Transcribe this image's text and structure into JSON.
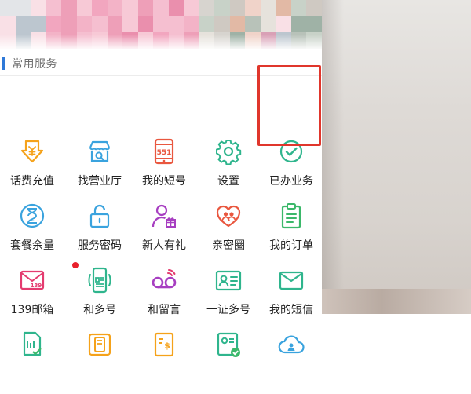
{
  "section": {
    "title": "常用服务"
  },
  "colors": {
    "accent_bar": "#2f79d8",
    "highlight_box": "#e0362c",
    "badge": "#e8202b",
    "orange": "#f5a21a",
    "blue": "#3aa3de",
    "teal": "#2fb58d",
    "green": "#3bb86a",
    "purple": "#a73ec1",
    "red": "#e9573f",
    "pink": "#e43b6f"
  },
  "services": [
    {
      "label": "话费充值",
      "icon": "recharge-coin-icon"
    },
    {
      "label": "找营业厅",
      "icon": "store-search-icon"
    },
    {
      "label": "我的短号",
      "icon": "short-number-phone-icon"
    },
    {
      "label": "设置",
      "icon": "gear-icon"
    },
    {
      "label": "已办业务",
      "icon": "check-circle-icon"
    },
    {
      "label": "套餐余量",
      "icon": "hourglass-icon"
    },
    {
      "label": "服务密码",
      "icon": "lock-icon"
    },
    {
      "label": "新人有礼",
      "icon": "user-gift-icon"
    },
    {
      "label": "亲密圈",
      "icon": "heart-people-icon"
    },
    {
      "label": "我的订单",
      "icon": "clipboard-list-icon"
    },
    {
      "label": "139邮箱",
      "icon": "mail-139-icon",
      "badge": true
    },
    {
      "label": "和多号",
      "icon": "multi-number-phone-icon"
    },
    {
      "label": "和留言",
      "icon": "voicemail-icon"
    },
    {
      "label": "一证多号",
      "icon": "id-card-icon"
    },
    {
      "label": "我的短信",
      "icon": "envelope-icon"
    },
    {
      "label": "",
      "icon": "sim-card-check-icon"
    },
    {
      "label": "",
      "icon": "phone-card-icon"
    },
    {
      "label": "",
      "icon": "bill-dollar-icon"
    },
    {
      "label": "",
      "icon": "id-card-check-icon"
    },
    {
      "label": "",
      "icon": "cloud-people-icon"
    }
  ]
}
